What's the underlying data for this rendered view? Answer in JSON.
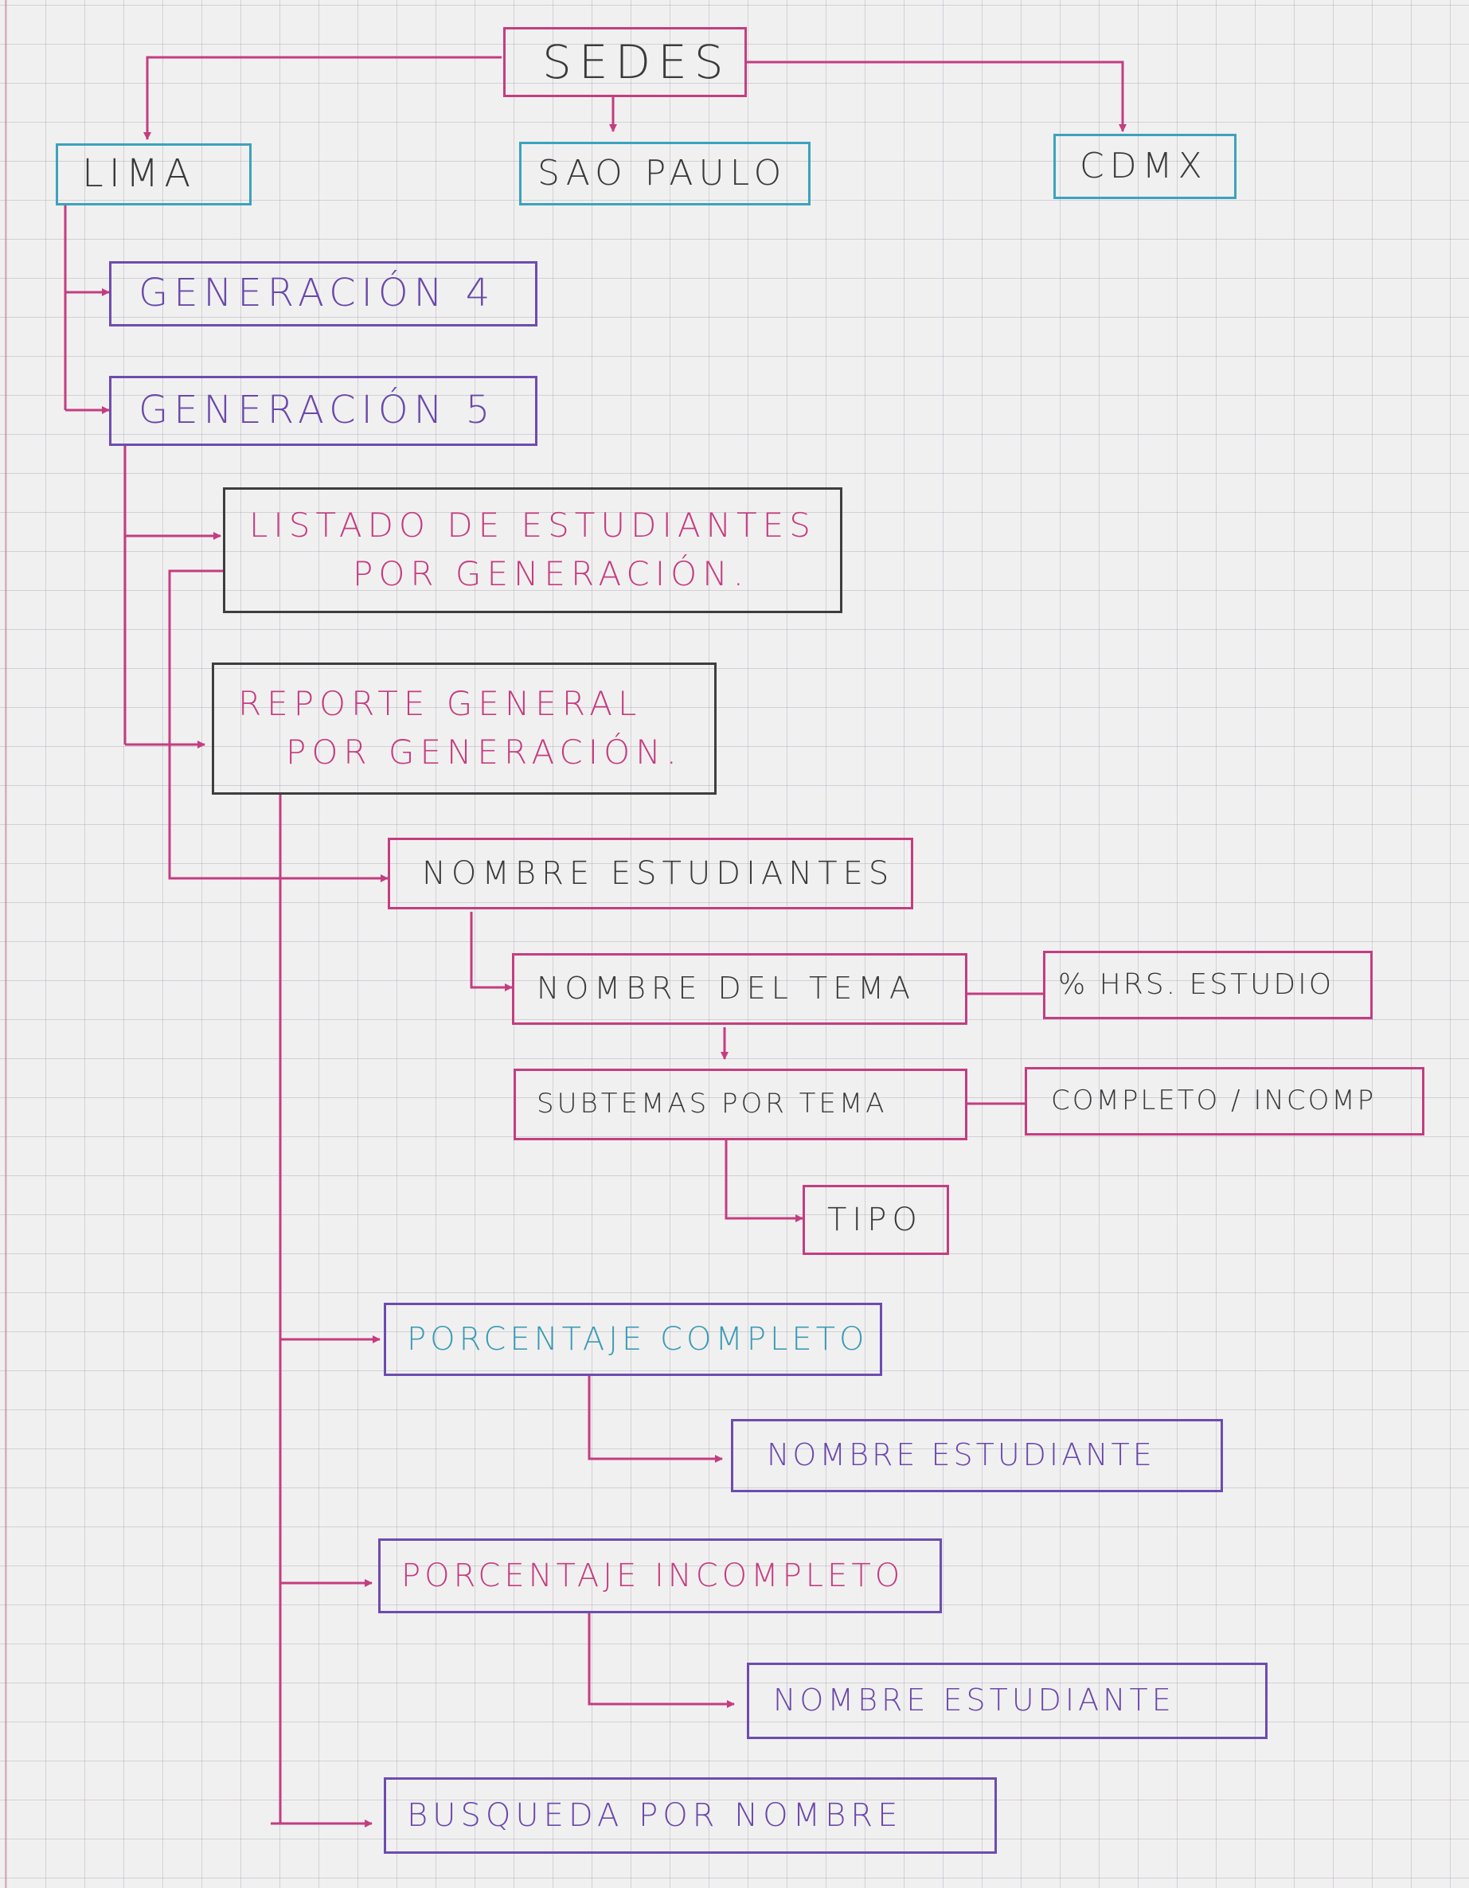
{
  "diagram": {
    "root": "SEDES",
    "sedes": [
      "LIMA",
      "SAO PAULO",
      "CDMX"
    ],
    "generaciones": [
      "GENERACIÓN 4",
      "GENERACIÓN 5"
    ],
    "listado": [
      "LISTADO DE ESTUDIANTES",
      "POR GENERACIÓN."
    ],
    "reporte": [
      "REPORTE GENERAL",
      "POR GENERACIÓN."
    ],
    "nombre_estudiantes": "NOMBRE ESTUDIANTES",
    "nombre_tema": "NOMBRE DEL TEMA",
    "hrs_estudio": "% HRS. ESTUDIO",
    "subtemas": "SUBTEMAS POR TEMA",
    "completo_incomp": "COMPLETO / INCOMP",
    "tipo": "TIPO",
    "porcentaje_completo": "PORCENTAJE COMPLETO",
    "nombre_estudiante_1": "NOMBRE ESTUDIANTE",
    "porcentaje_incompleto": "PORCENTAJE INCOMPLETO",
    "nombre_estudiante_2": "NOMBRE ESTUDIANTE",
    "busqueda": "BUSQUEDA POR NOMBRE"
  },
  "colors": {
    "ink_pink": "#c43d80",
    "ink_cyan": "#3aa3bd",
    "ink_purple": "#6d4cb0",
    "ink_dark": "#3e3e3e",
    "paper": "#f1f0f0"
  }
}
